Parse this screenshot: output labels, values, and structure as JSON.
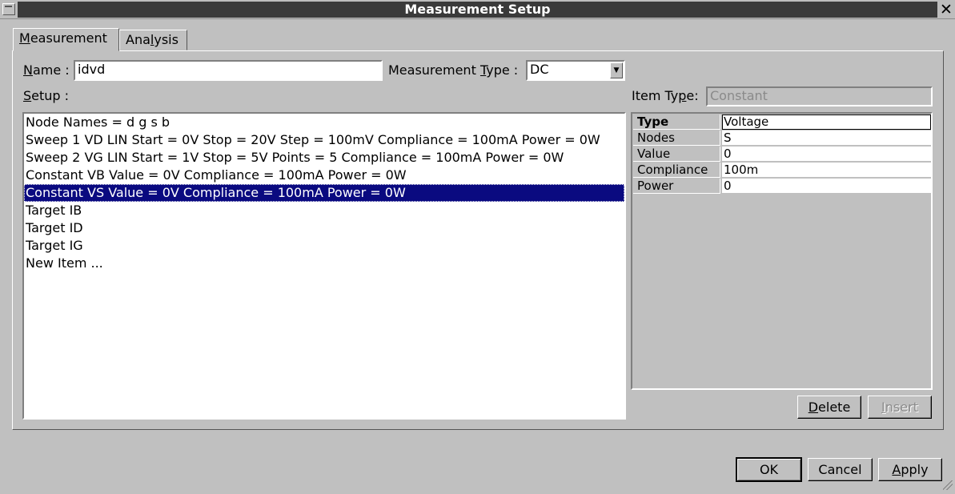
{
  "window": {
    "title": "Measurement Setup",
    "close_glyph": "✕"
  },
  "tabs": [
    {
      "label_pre": "",
      "label_ul": "M",
      "label_post": "easurement",
      "active": true
    },
    {
      "label_pre": "Ana",
      "label_ul": "l",
      "label_post": "ysis",
      "active": false
    }
  ],
  "form": {
    "name_label_ul": "N",
    "name_label_rest": "ame :",
    "name_value": "idvd",
    "mtype_label_pre": "Measurement ",
    "mtype_label_ul": "T",
    "mtype_label_post": "ype :",
    "mtype_value": "DC",
    "setup_label_ul": "S",
    "setup_label_rest": "etup :",
    "itemtype_label_pre": "Item Ty",
    "itemtype_label_ul": "p",
    "itemtype_label_post": "e:",
    "itemtype_placeholder": "Constant"
  },
  "setup_items": [
    "Node Names = d g s b",
    "Sweep 1 VD LIN Start = 0V Stop = 20V Step = 100mV Compliance = 100mA Power = 0W",
    "Sweep 2 VG LIN Start = 1V Stop = 5V Points = 5 Compliance = 100mA Power = 0W",
    "Constant VB Value = 0V Compliance = 100mA Power = 0W",
    "Constant VS Value = 0V Compliance = 100mA Power = 0W",
    "Target IB",
    "Target ID",
    "Target IG",
    "New Item ..."
  ],
  "selected_index": 4,
  "properties": [
    {
      "key": "Type",
      "value": "Voltage"
    },
    {
      "key": "Nodes",
      "value": "S"
    },
    {
      "key": "Value",
      "value": "0"
    },
    {
      "key": "Compliance",
      "value": "100m"
    },
    {
      "key": "Power",
      "value": "0"
    }
  ],
  "buttons": {
    "delete_ul": "D",
    "delete_rest": "elete",
    "insert_ul": "I",
    "insert_rest": "nsert",
    "ok": "OK",
    "cancel": "Cancel",
    "apply_ul": "A",
    "apply_rest": "pply"
  },
  "colors": {
    "selection_bg": "#0a0a80",
    "title_bg": "#3a3a3a",
    "dialog_bg": "#c0c0c0"
  }
}
